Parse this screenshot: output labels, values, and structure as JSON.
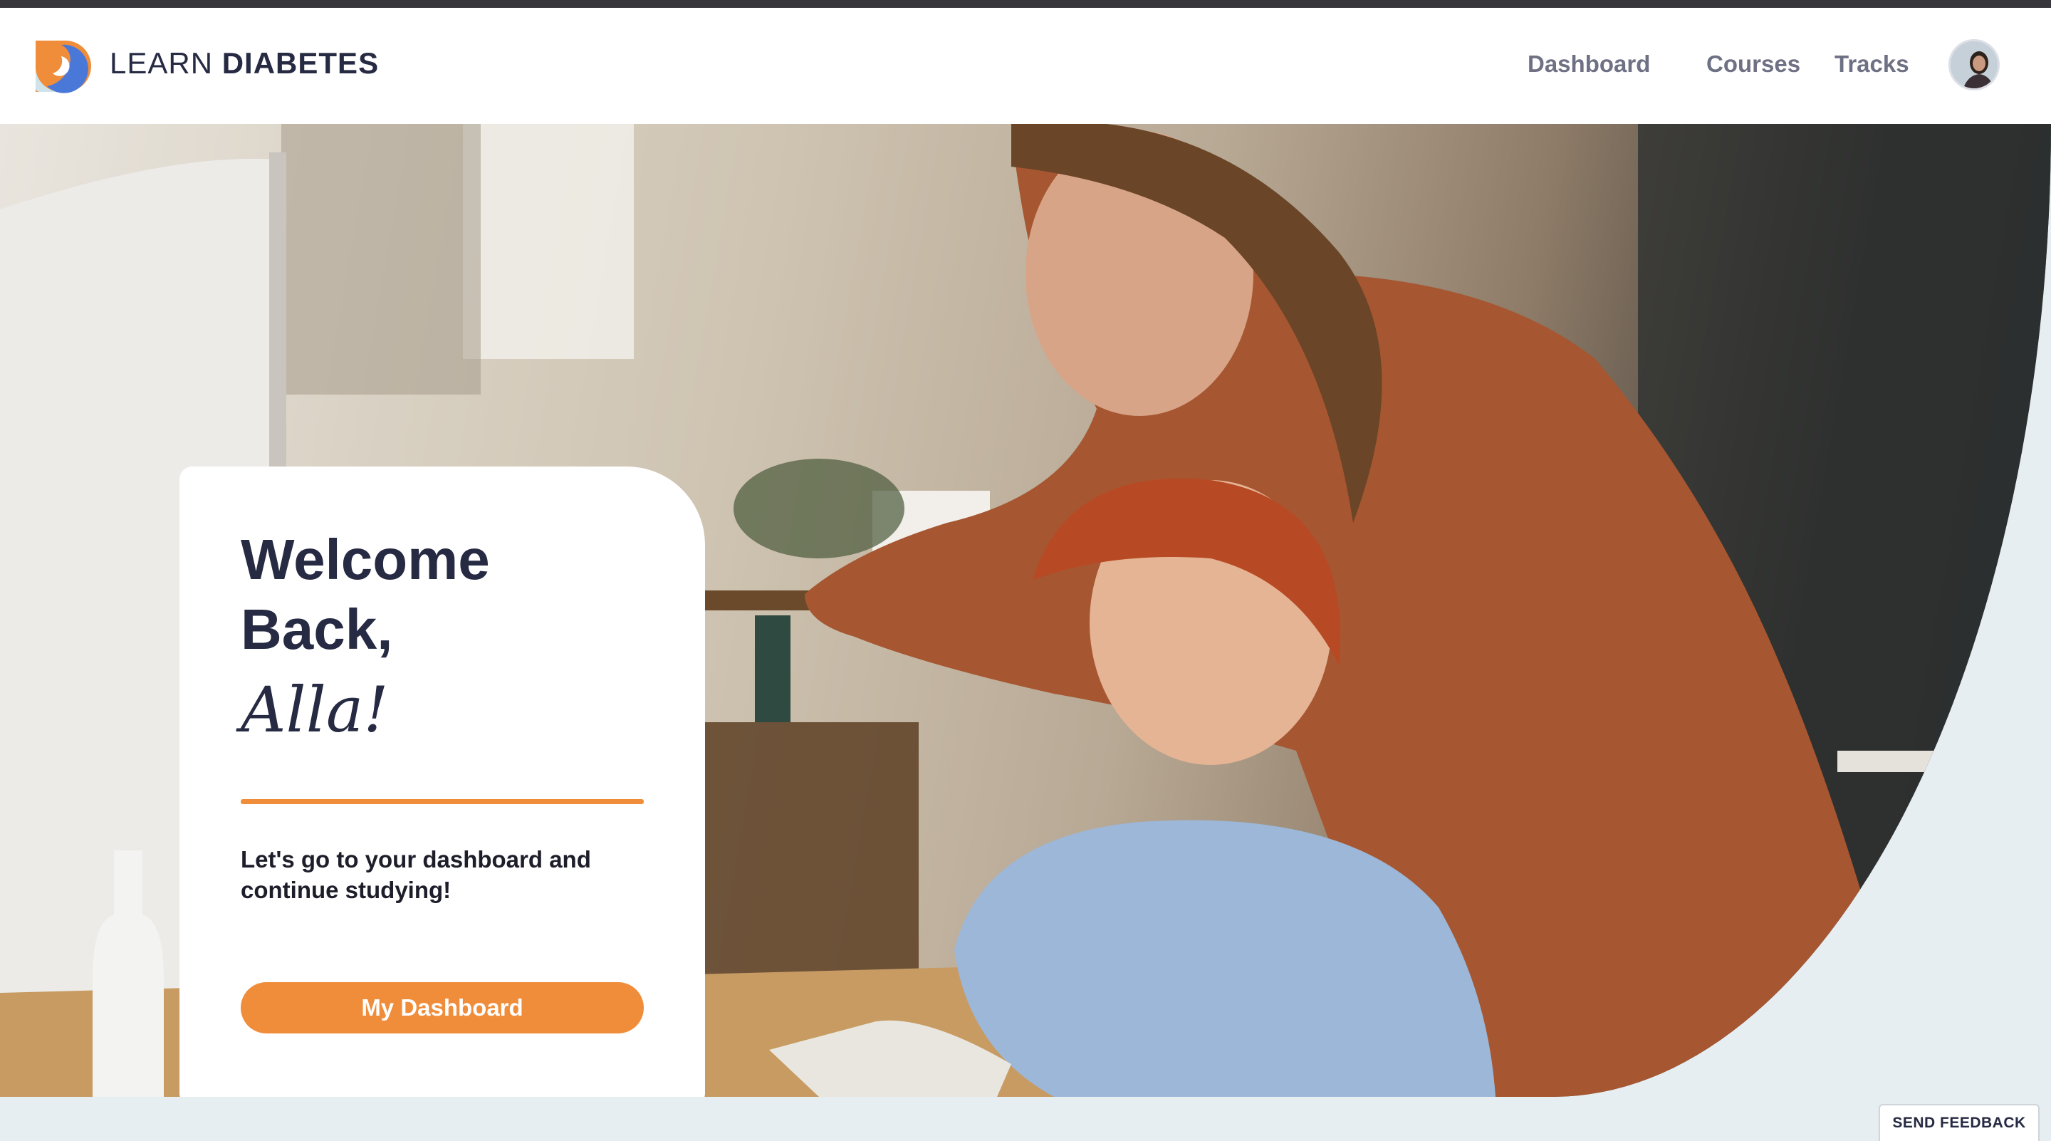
{
  "app": {
    "brand_light": "LEARN ",
    "brand_bold": "DIABETES",
    "logo_icon": "learn-diabetes-logo"
  },
  "nav": {
    "dashboard": "Dashboard",
    "courses": "Courses",
    "tracks": "Tracks",
    "avatar_icon": "user-avatar"
  },
  "hero": {
    "image_subject": "parent-and-child-at-computer-photo"
  },
  "welcome": {
    "heading": "Welcome Back,",
    "name": "Alla!",
    "message": "Let's go to your dashboard and continue studying!",
    "button_label": "My Dashboard"
  },
  "feedback": {
    "label": "SEND FEEDBACK"
  },
  "colors": {
    "accent": "#f08d3a",
    "text_dark": "#262a42",
    "nav_text": "#6e7084",
    "page_bg": "#e7eef2"
  }
}
